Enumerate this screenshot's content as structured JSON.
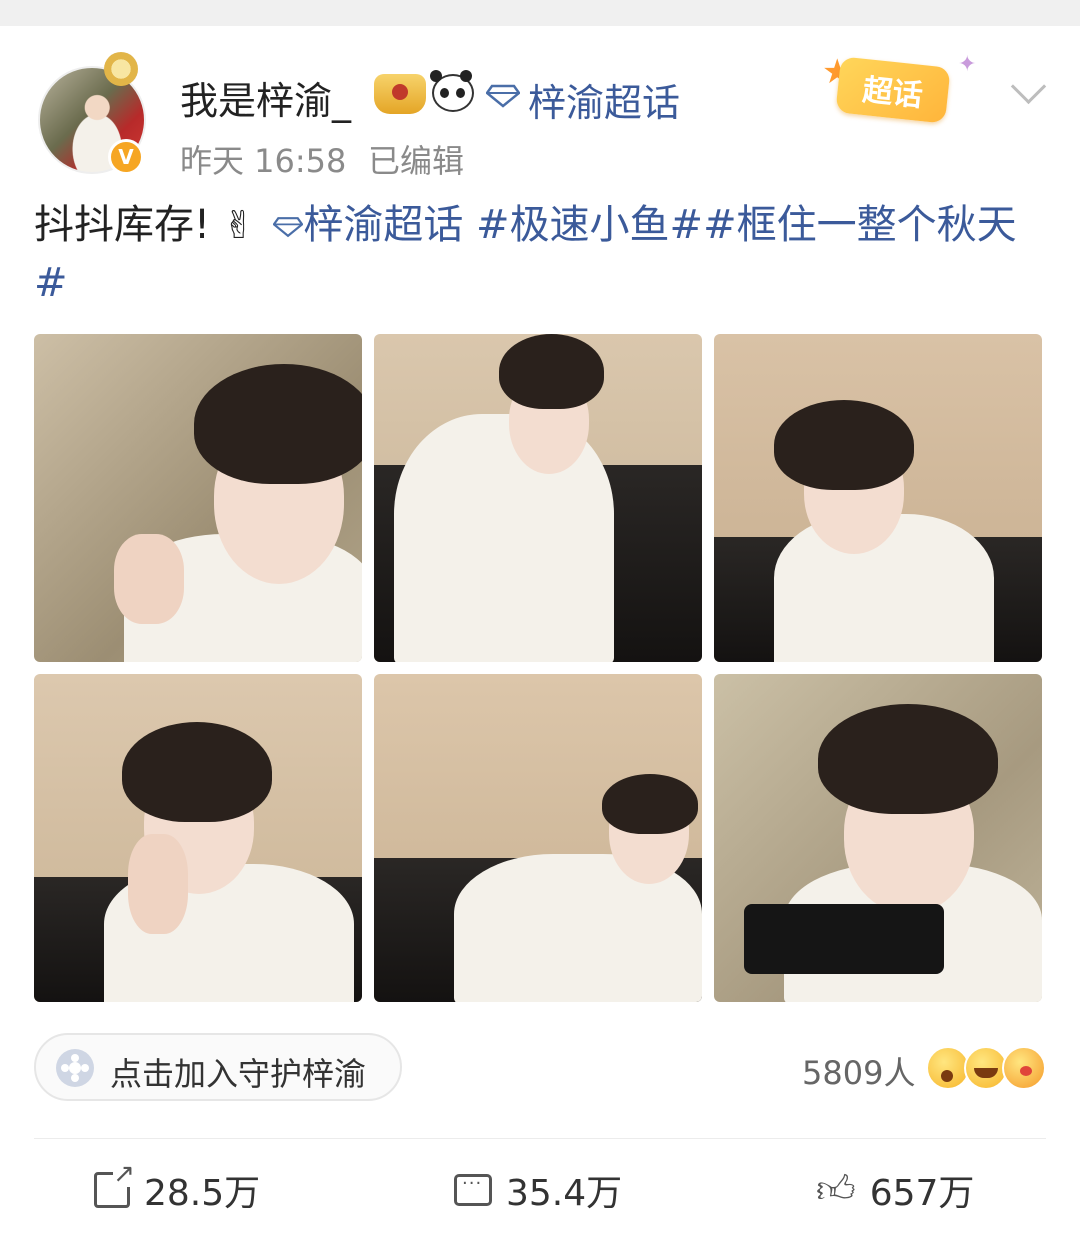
{
  "header": {
    "username": "我是梓渝_",
    "topic_link": "梓渝超话",
    "super_topic_badge": "超话",
    "time": "昨天 16:58",
    "edited": "已编辑"
  },
  "post": {
    "text_plain": "抖抖库存!",
    "topic_inline": "梓渝超话",
    "hashtags": "#极速小鱼##框住一整个秋天#"
  },
  "images": [
    {
      "label": "photo-1"
    },
    {
      "label": "photo-2"
    },
    {
      "label": "photo-3"
    },
    {
      "label": "photo-4"
    },
    {
      "label": "photo-5"
    },
    {
      "label": "photo-6"
    }
  ],
  "guard": {
    "label": "点击加入守护梓渝"
  },
  "reactions": {
    "count": "5809人"
  },
  "actions": {
    "share": "28.5万",
    "comment": "35.4万",
    "like": "657万"
  },
  "colors": {
    "link": "#3b5a9a",
    "meta": "#8a8a8a",
    "badge": "#ffb53b"
  }
}
